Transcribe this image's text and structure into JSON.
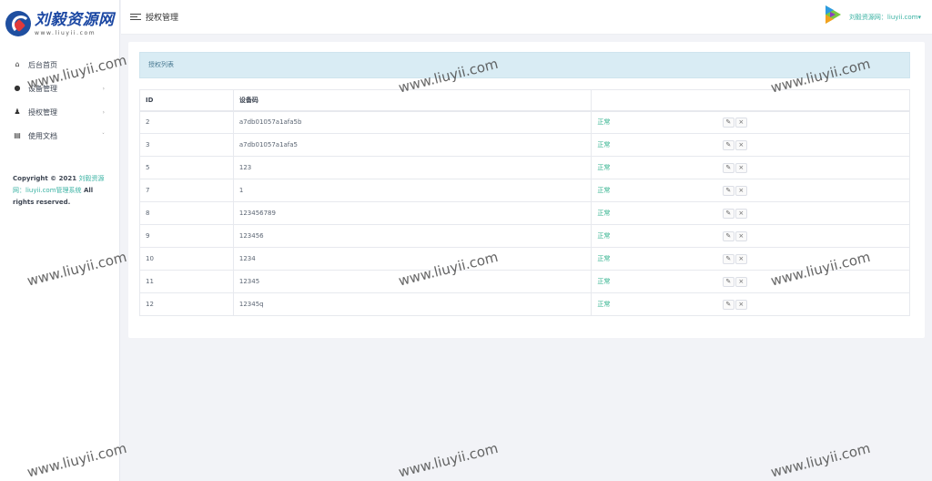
{
  "logo": {
    "title": "刘毅资源网",
    "subtitle": "www.liuyii.com"
  },
  "sidebar": {
    "items": [
      {
        "label": "后台首页",
        "icon": "home-icon",
        "has_caret": false
      },
      {
        "label": "设备管理",
        "icon": "palette-icon",
        "has_caret": true
      },
      {
        "label": "授权管理",
        "icon": "user-gear-icon",
        "has_caret": true
      },
      {
        "label": "使用文档",
        "icon": "document-icon",
        "has_caret": true
      }
    ],
    "copyright": {
      "prefix": "Copyright © 2021",
      "link": "刘毅资源网：liuyii.com管理系统",
      "suffix": "All rights reserved."
    }
  },
  "header": {
    "title": "授权管理",
    "user": "刘毅资源网：liuyii.com"
  },
  "panel": {
    "title": "授权列表"
  },
  "table": {
    "columns": [
      "ID",
      "设备码",
      "",
      ""
    ],
    "rows": [
      {
        "id": "2",
        "code": "a7db01057a1afa5b",
        "status": "正常"
      },
      {
        "id": "3",
        "code": "a7db01057a1afa5",
        "status": "正常"
      },
      {
        "id": "5",
        "code": "123",
        "status": "正常"
      },
      {
        "id": "7",
        "code": "1",
        "status": "正常"
      },
      {
        "id": "8",
        "code": "123456789",
        "status": "正常"
      },
      {
        "id": "9",
        "code": "123456",
        "status": "正常"
      },
      {
        "id": "10",
        "code": "1234",
        "status": "正常"
      },
      {
        "id": "11",
        "code": "12345",
        "status": "正常"
      },
      {
        "id": "12",
        "code": "12345q",
        "status": "正常"
      }
    ]
  },
  "watermark": "www.liuyii.com",
  "colors": {
    "accent": "#3ab2a3",
    "status_ok": "#2fb28c",
    "panel_head": "#d9ecf4",
    "logo_blue": "#1c48a3"
  }
}
